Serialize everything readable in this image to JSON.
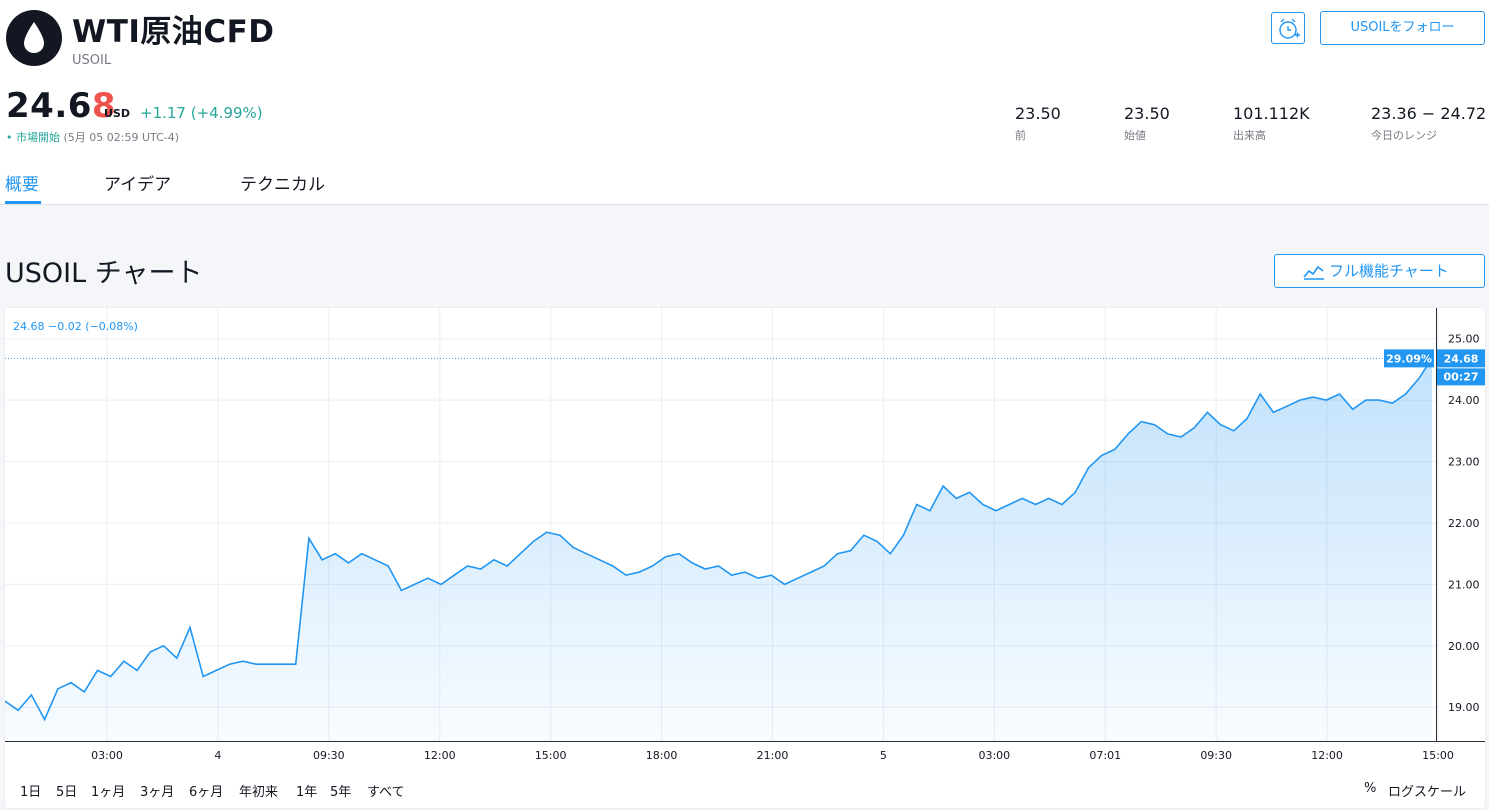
{
  "header": {
    "title": "WTI原油CFD",
    "ticker": "USOIL",
    "follow_label": "USOILをフォロー"
  },
  "quote": {
    "price_main": "24.6",
    "price_last": "8",
    "currency": "USD",
    "change": "+1.17 (+4.99%)",
    "status": "市場開始",
    "status_time": "(5月 05 02:59 UTC-4)"
  },
  "stats": [
    {
      "value": "23.50",
      "label": "前"
    },
    {
      "value": "23.50",
      "label": "始値"
    },
    {
      "value": "101.112K",
      "label": "出来高"
    },
    {
      "value": "23.36 − 24.72",
      "label": "今日のレンジ"
    }
  ],
  "tabs": [
    {
      "label": "概要"
    },
    {
      "label": "アイデア"
    },
    {
      "label": "テクニカル"
    }
  ],
  "chart_section": {
    "title": "USOIL チャート",
    "full_chart_label": "フル機能チャート",
    "legend": "24.68  −0.02 (−0.08%)",
    "range_buttons": [
      "1日",
      "5日",
      "1ヶ月",
      "3ヶ月",
      "6ヶ月",
      "年初来",
      "1年",
      "5年",
      "すべて"
    ],
    "percent_label": "%",
    "log_label": "ログスケール"
  },
  "colors": {
    "accent": "#2196f3",
    "up": "#26a69a",
    "down": "#ef5350",
    "text": "#131722",
    "muted": "#787b86"
  },
  "chart_data": {
    "type": "area",
    "x_labels": [
      "03:00",
      "4",
      "09:30",
      "12:00",
      "15:00",
      "18:00",
      "21:00",
      "5",
      "03:00",
      "07:01",
      "09:30",
      "12:00",
      "15:00"
    ],
    "y_ticks": [
      19.0,
      20.0,
      21.0,
      22.0,
      23.0,
      24.0,
      25.0
    ],
    "ylim": [
      18.45,
      25.5
    ],
    "last_value": 24.68,
    "last_value_label": "24.68",
    "percent_badge": "29.09%",
    "countdown": "00:27",
    "grid": true,
    "series": [
      {
        "values": [
          19.1,
          18.95,
          19.2,
          18.8,
          19.3,
          19.4,
          19.25,
          19.6,
          19.5,
          19.75,
          19.6,
          19.9,
          20.0,
          19.8,
          20.3,
          19.5,
          19.6,
          19.7,
          19.75,
          19.7,
          19.7,
          19.7,
          19.7,
          21.75,
          21.4,
          21.5,
          21.35,
          21.5,
          21.4,
          21.3,
          20.9,
          21.0,
          21.1,
          21.0,
          21.15,
          21.3,
          21.25,
          21.4,
          21.3,
          21.5,
          21.7,
          21.85,
          21.8,
          21.6,
          21.5,
          21.4,
          21.3,
          21.15,
          21.2,
          21.3,
          21.45,
          21.5,
          21.35,
          21.25,
          21.3,
          21.15,
          21.2,
          21.1,
          21.15,
          21.0,
          21.1,
          21.2,
          21.3,
          21.5,
          21.55,
          21.8,
          21.7,
          21.5,
          21.8,
          22.3,
          22.2,
          22.6,
          22.4,
          22.5,
          22.3,
          22.2,
          22.3,
          22.4,
          22.3,
          22.4,
          22.3,
          22.5,
          22.9,
          23.1,
          23.2,
          23.45,
          23.65,
          23.6,
          23.45,
          23.4,
          23.55,
          23.8,
          23.6,
          23.5,
          23.7,
          24.1,
          23.8,
          23.9,
          24.0,
          24.05,
          24.0,
          24.1,
          23.85,
          24.0,
          24.0,
          23.95,
          24.1,
          24.35,
          24.68
        ]
      }
    ]
  }
}
